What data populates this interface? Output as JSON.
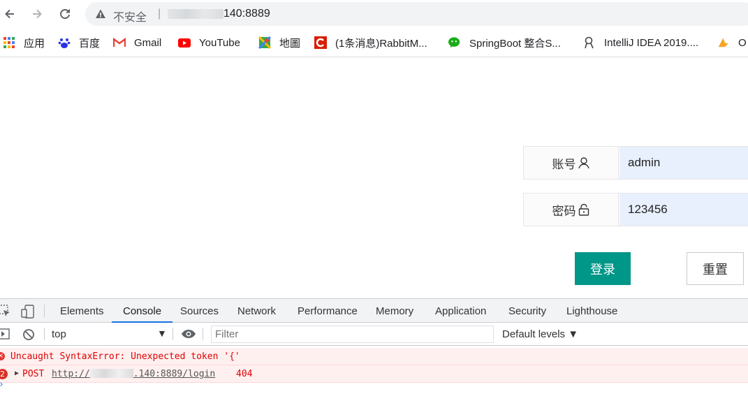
{
  "browser": {
    "security_label": "不安全",
    "separator": "|",
    "url_visible": "140:8889",
    "bookmarks": [
      {
        "label": "应用",
        "icon": "apps-grid-icon"
      },
      {
        "label": "百度",
        "icon": "baidu-paw-icon"
      },
      {
        "label": "Gmail",
        "icon": "gmail-icon"
      },
      {
        "label": "YouTube",
        "icon": "youtube-icon"
      },
      {
        "label": "地圖",
        "icon": "maps-icon"
      },
      {
        "label": "(1条消息)RabbitM...",
        "icon": "csdn-icon"
      },
      {
        "label": "SpringBoot 整合S...",
        "icon": "wechat-icon"
      },
      {
        "label": "IntelliJ IDEA 2019....",
        "icon": "intellij-icon"
      },
      {
        "label": "O",
        "icon": "bookmark-orange-icon"
      }
    ]
  },
  "login": {
    "username_label": "账号",
    "username_value": "admin",
    "password_label": "密码",
    "password_value": "123456",
    "login_button": "登录",
    "reset_button": "重置",
    "colors": {
      "primary": "#009688",
      "autofill_bg": "#e8f0fe"
    }
  },
  "devtools": {
    "tabs": [
      "Elements",
      "Console",
      "Sources",
      "Network",
      "Performance",
      "Memory",
      "Application",
      "Security",
      "Lighthouse"
    ],
    "active_tab": "Console",
    "context": "top",
    "filter_placeholder": "Filter",
    "levels": "Default levels ▼",
    "messages": [
      {
        "type": "error",
        "text": "Uncaught SyntaxError: Unexpected token '{'"
      },
      {
        "type": "error",
        "count": "2",
        "method": "POST",
        "url_prefix": "http://",
        "url_suffix": ".140:8889/login",
        "status": "404"
      }
    ],
    "colors": {
      "error_text": "#e00000",
      "error_bg": "#fff0f0",
      "active_tab": "#1a73e8"
    }
  }
}
